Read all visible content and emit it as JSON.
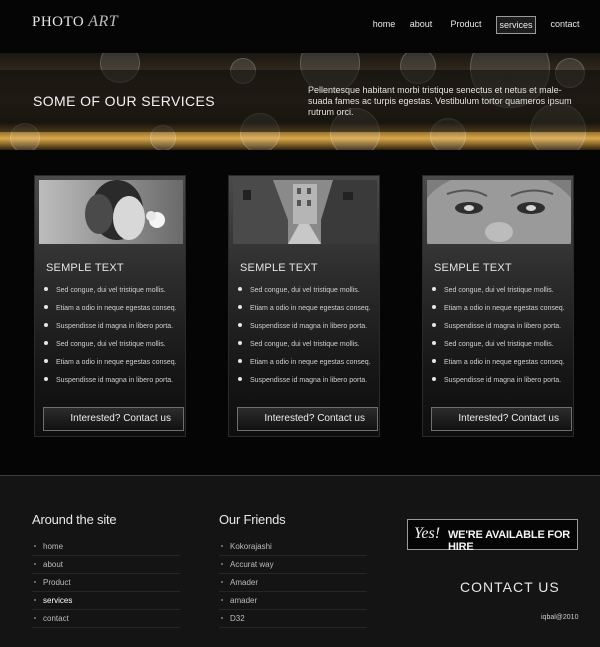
{
  "logo": {
    "word1": "PHOTO",
    "word2": "ART"
  },
  "nav": [
    "home",
    "about",
    "Product",
    "services",
    "contact"
  ],
  "banner": {
    "title": "SOME OF OUR SERVICES",
    "description": "Pellentesque habitant morbi tristique senectus et netus et male-suada fames ac turpis egestas. Vestibulum tortor quameros ipsum rutrum orci."
  },
  "cards": [
    {
      "heading": "SEMPLE TEXT",
      "items": [
        "Sed congue, dui vel tristique mollis.",
        "Etiam a odio in neque egestas conseq.",
        "Suspendisse id magna in libero porta.",
        "Sed congue, dui vel tristique mollis.",
        "Etiam a odio in neque egestas conseq.",
        "Suspendisse id magna in libero porta."
      ],
      "button": "Interested? Contact us"
    },
    {
      "heading": "SEMPLE TEXT",
      "items": [
        "Sed congue, dui vel tristique mollis.",
        "Etiam a odio in neque egestas conseq.",
        "Suspendisse id magna in libero porta.",
        "Sed congue, dui vel tristique mollis.",
        "Etiam a odio in neque egestas conseq.",
        "Suspendisse id magna in libero porta."
      ],
      "button": "Interested? Contact us"
    },
    {
      "heading": "SEMPLE TEXT",
      "items": [
        "Sed congue, dui vel tristique mollis.",
        "Etiam a odio in neque egestas conseq.",
        "Suspendisse id magna in libero porta.",
        "Sed congue, dui vel tristique mollis.",
        "Etiam a odio in neque egestas conseq.",
        "Suspendisse id magna in libero porta."
      ],
      "button": "Interested? Contact us"
    }
  ],
  "footer": {
    "around": {
      "heading": "Around the site",
      "links": [
        "home",
        "about",
        "Product",
        "services",
        "contact"
      ]
    },
    "friends": {
      "heading": "Our Friends",
      "links": [
        "Kokorajashi",
        "Accurat way",
        "Amader",
        "amader",
        "D32"
      ]
    },
    "hire": {
      "yes": "Yes!",
      "text": "WE'RE AVAILABLE FOR HIRE"
    },
    "contact": "CONTACT US",
    "credit": "iqbal@2010"
  }
}
